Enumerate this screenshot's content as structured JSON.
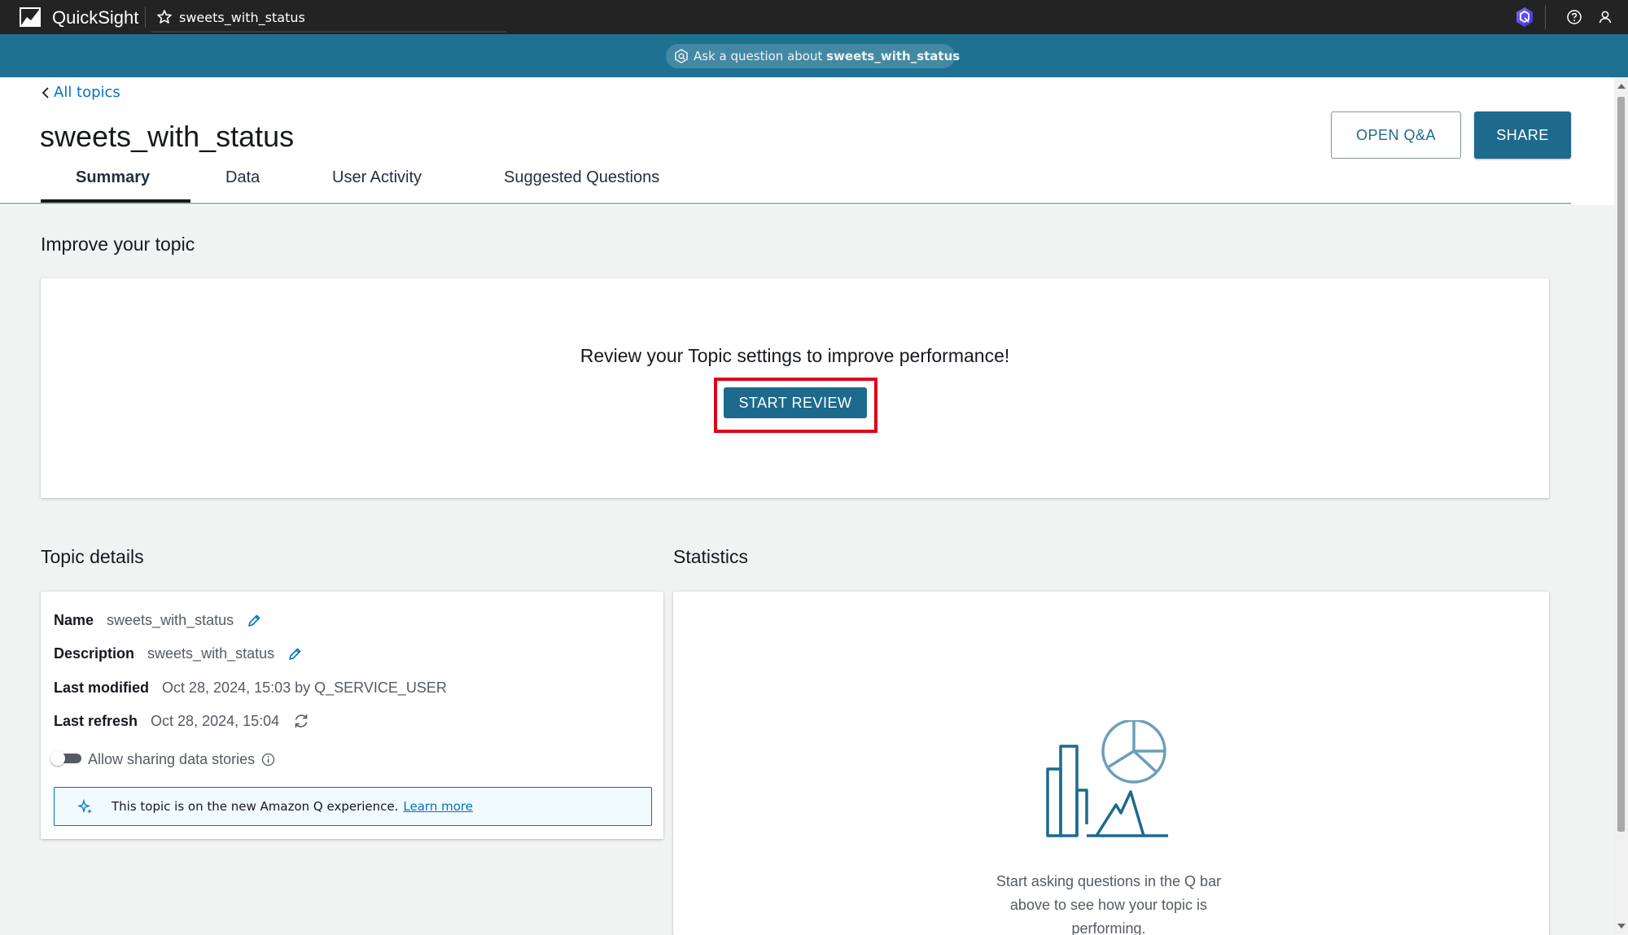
{
  "app": {
    "brand": "QuickSight",
    "open_topic_tab": "sweets_with_status"
  },
  "qbar": {
    "prefix": "Ask a question about ",
    "topic": "sweets_with_status"
  },
  "header": {
    "back_label": "All topics",
    "title": "sweets_with_status",
    "open_qa_label": "OPEN Q&A",
    "share_label": "SHARE",
    "tabs": [
      {
        "label": "Summary",
        "active": true
      },
      {
        "label": "Data",
        "active": false
      },
      {
        "label": "User Activity",
        "active": false
      },
      {
        "label": "Suggested Questions",
        "active": false
      }
    ]
  },
  "improve": {
    "section_title": "Improve your topic",
    "message": "Review your Topic settings to improve performance!",
    "button_label": "START REVIEW"
  },
  "details": {
    "section_title": "Topic details",
    "name_label": "Name",
    "name_value": "sweets_with_status",
    "description_label": "Description",
    "description_value": "sweets_with_status",
    "modified_label": "Last modified",
    "modified_value": "Oct 28, 2024, 15:03 by Q_SERVICE_USER",
    "refresh_label": "Last refresh",
    "refresh_value": "Oct 28, 2024, 15:04",
    "sharing_label": "Allow sharing data stories",
    "info_text": "This topic is on the new Amazon Q experience.",
    "info_link": "Learn more"
  },
  "statistics": {
    "section_title": "Statistics",
    "empty_text": "Start asking questions in the Q bar above to see how your topic is performing."
  },
  "colors": {
    "primary": "#1e6a8d",
    "qbar": "#1e7191",
    "link": "#0073bb",
    "highlight": "#e0001a"
  },
  "icons": [
    "quicksight-logo-icon",
    "star-icon",
    "amazon-q-icon",
    "help-icon",
    "user-icon",
    "chevron-left-icon",
    "pencil-icon",
    "refresh-icon",
    "info-icon",
    "sparkle-icon",
    "statistics-illustration"
  ]
}
